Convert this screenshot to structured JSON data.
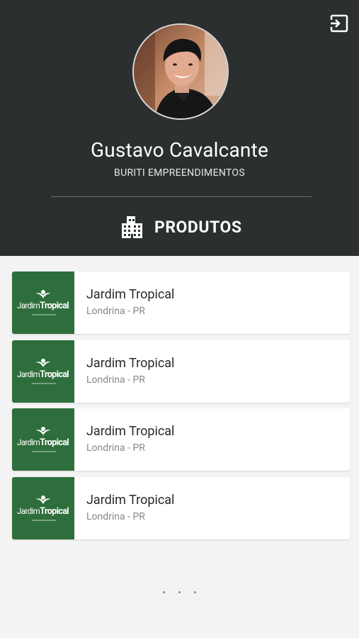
{
  "profile": {
    "name": "Gustavo Cavalcante",
    "company": "BURITI EMPREENDIMENTOS"
  },
  "section": {
    "title": "PRODUTOS",
    "icon": "building-icon"
  },
  "header": {
    "logout_icon": "logout-icon",
    "background_color": "#2b2f2f"
  },
  "products": [
    {
      "title": "Jardim Tropical",
      "location": "Londrina - PR",
      "logo_text_1": "Jardim",
      "logo_text_2": "Tropical"
    },
    {
      "title": "Jardim Tropical",
      "location": "Londrina - PR",
      "logo_text_1": "Jardim",
      "logo_text_2": "Tropical"
    },
    {
      "title": "Jardim Tropical",
      "location": "Londrina - PR",
      "logo_text_1": "Jardim",
      "logo_text_2": "Tropical"
    },
    {
      "title": "Jardim Tropical",
      "location": "Londrina - PR",
      "logo_text_1": "Jardim",
      "logo_text_2": "Tropical"
    }
  ],
  "colors": {
    "thumb_green": "#2e6e3c",
    "accent_white": "#ffffff"
  },
  "loading_indicator": "three-dots"
}
